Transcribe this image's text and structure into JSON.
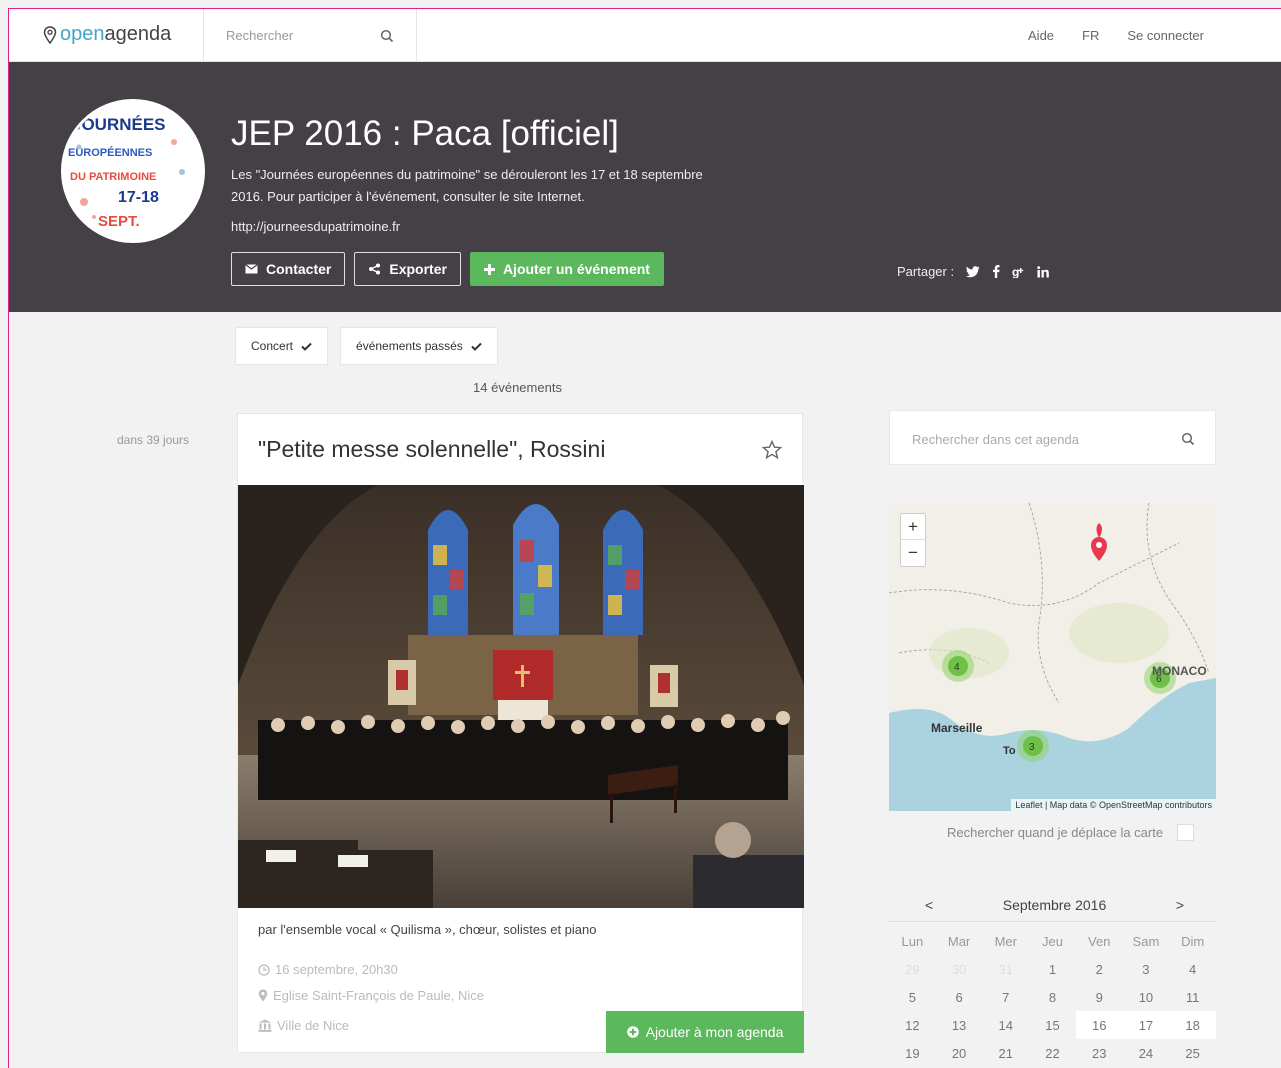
{
  "topbar": {
    "logo_open": "open",
    "logo_agenda": "agenda",
    "search_placeholder": "Rechercher",
    "links": [
      "Aide",
      "FR",
      "Se connecter"
    ]
  },
  "header": {
    "title": "JEP 2016 : Paca [officiel]",
    "description": "Les \"Journées européennes du patrimoine\" se dérouleront les 17 et 18 septembre 2016. Pour participer à l'événement, consulter le site Internet.",
    "url": "http://journeesdupatrimoine.fr",
    "avatar_text": [
      "JOURNÉES",
      "EUROPÉENNES",
      "DU PATRIMOINE",
      "17-18",
      "SEPT."
    ],
    "buttons": {
      "contact": "Contacter",
      "export": "Exporter",
      "add_event": "Ajouter un événement"
    },
    "share_label": "Partager :",
    "share_icons": [
      "twitter-icon",
      "facebook-icon",
      "google-plus-icon",
      "linkedin-icon"
    ]
  },
  "filters": [
    {
      "label": "Concert"
    },
    {
      "label": "événements passés"
    }
  ],
  "events_count": "14 événements",
  "event": {
    "relative_date": "dans 39 jours",
    "title": "\"Petite messe solennelle\", Rossini",
    "subtitle": "par l'ensemble vocal « Quilisma », chœur, solistes et piano",
    "date": "16 septembre, 20h30",
    "location": "Eglise Saint-François de Paule, Nice",
    "organizer": "Ville de Nice",
    "add_button": "Ajouter à mon agenda"
  },
  "sidebar": {
    "search_placeholder": "Rechercher dans cet agenda",
    "map": {
      "zoom_in": "+",
      "zoom_out": "−",
      "city_label": "Marseille",
      "city_partial": "To",
      "monaco_label": "MONACO",
      "clusters": [
        {
          "count": "4"
        },
        {
          "count": "6"
        },
        {
          "count": "3"
        }
      ],
      "attribution": "Leaflet | Map data © OpenStreetMap contributors"
    },
    "move_search_label": "Rechercher quand je déplace la carte",
    "calendar": {
      "prev": "<",
      "next": ">",
      "month": "Septembre 2016",
      "weekdays": [
        "Lun",
        "Mar",
        "Mer",
        "Jeu",
        "Ven",
        "Sam",
        "Dim"
      ],
      "days": [
        "29",
        "30",
        "31",
        "1",
        "2",
        "3",
        "4",
        "5",
        "6",
        "7",
        "8",
        "9",
        "10",
        "11",
        "12",
        "13",
        "14",
        "15",
        "16",
        "17",
        "18",
        "19",
        "20",
        "21",
        "22",
        "23",
        "24",
        "25"
      ]
    }
  },
  "colors": {
    "accent_green": "#5cb85c",
    "header_bg": "#454046",
    "logo_blue": "#41a6c9",
    "map_pin": "#e8384f",
    "sea": "#aad3df"
  }
}
